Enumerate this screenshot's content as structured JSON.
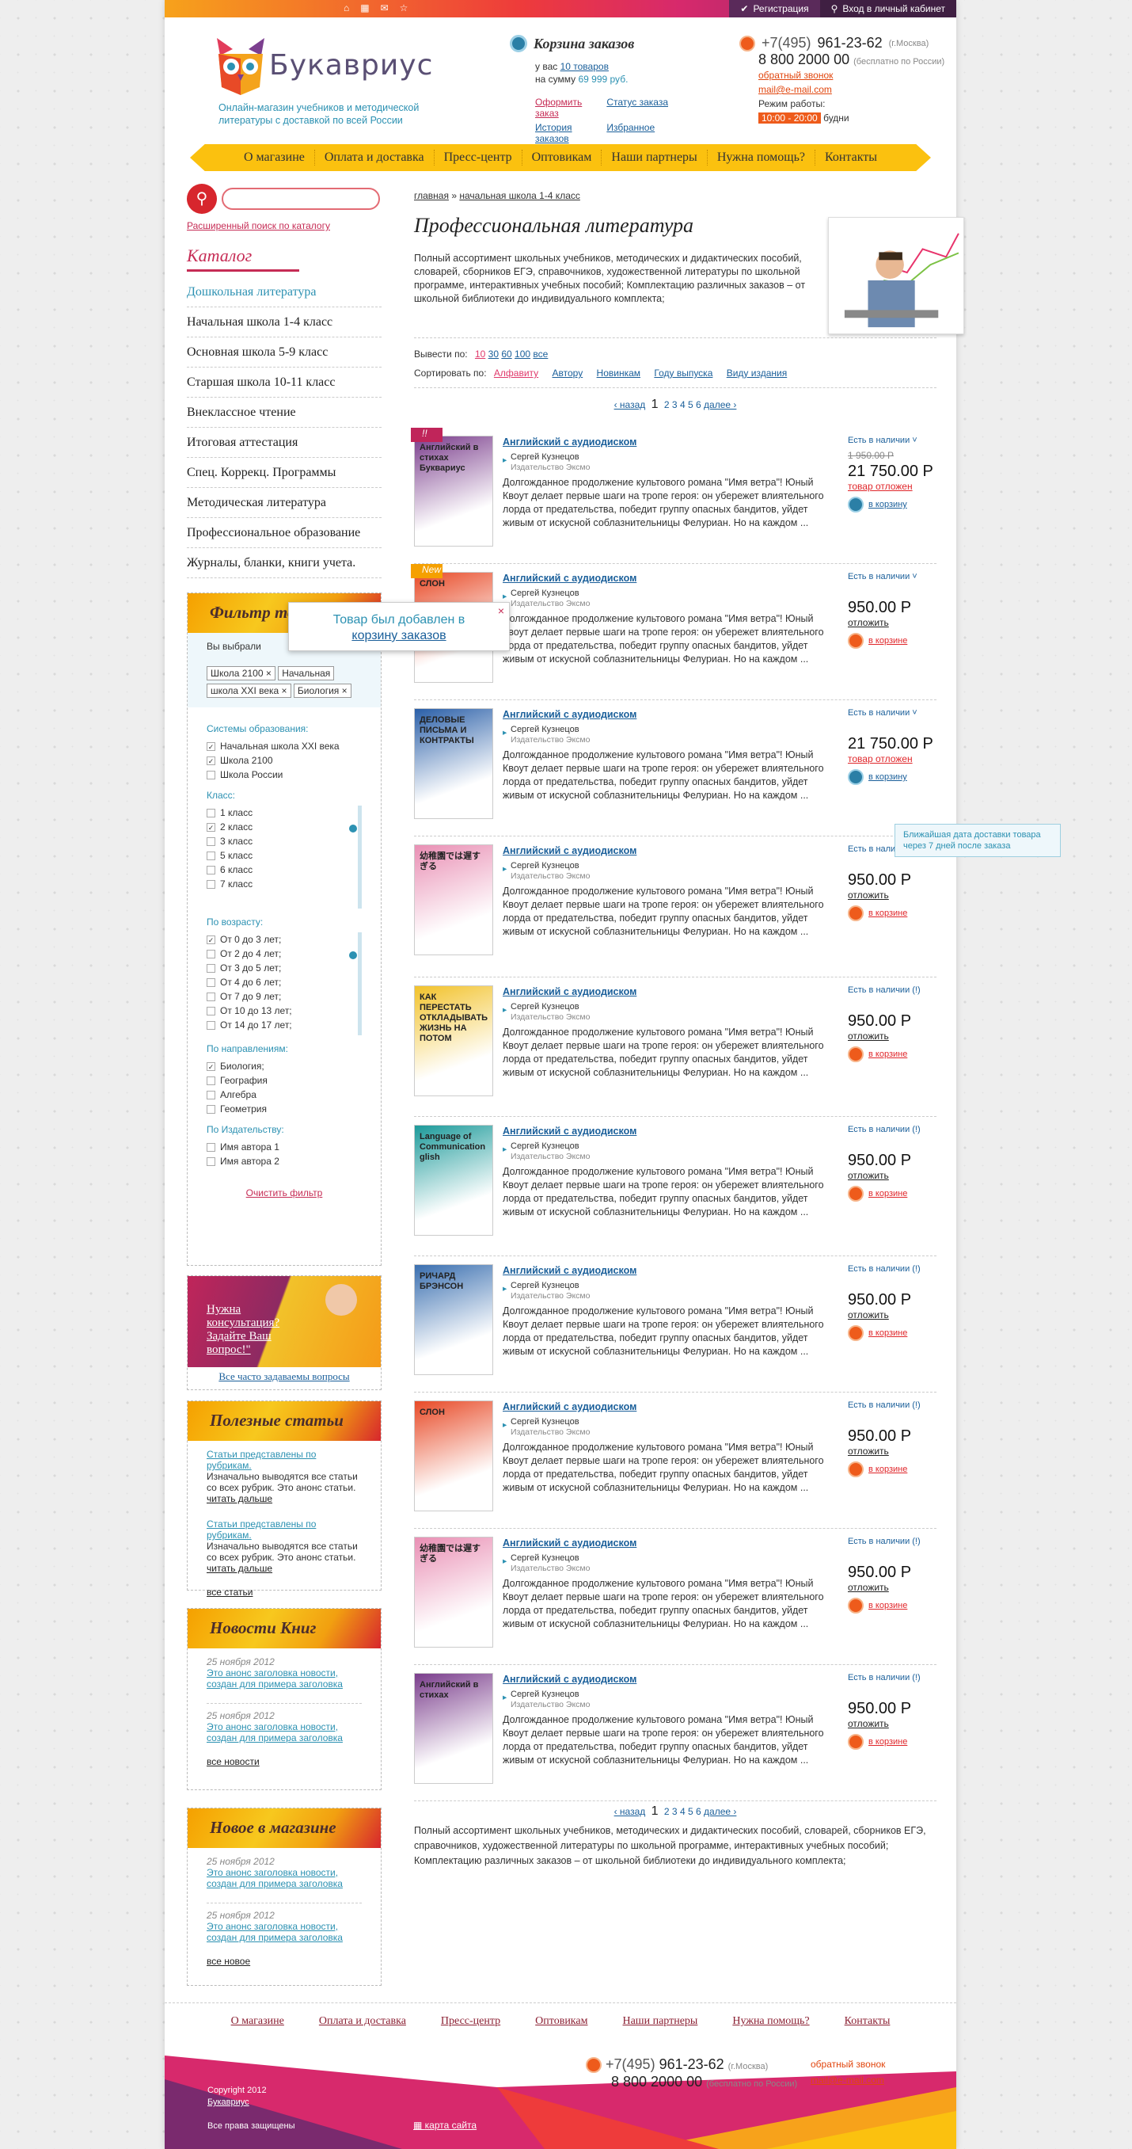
{
  "topbar": {
    "register": "Регистрация",
    "login": "Вход в личный кабинет"
  },
  "brand": {
    "name": "Букавриус",
    "tagline": "Онлайн-магазин учебников и методической литературы с доставкой по всей России"
  },
  "cart": {
    "title": "Корзина заказов",
    "sum_prefix": "у вас",
    "count": "10 товаров",
    "sum_label": "на сумму",
    "sum": "69 999 руб.",
    "links": [
      "Оформить заказ",
      "Статус заказа",
      "История заказов",
      "Избранное"
    ]
  },
  "contacts": {
    "phone1_code": "+7(495)",
    "phone1": "961-23-62",
    "phone1_city": "(г.Москва)",
    "phone2": "8 800 2000 00",
    "phone2_note": "(бесплатно по России)",
    "callback": "обратный звонок",
    "email": "mail@e-mail.com",
    "hours_label": "Режим работы:",
    "hours": "10:00 - 20:00",
    "hours_days": "будни"
  },
  "menu": [
    "О магазине",
    "Оплата и доставка",
    "Пресс-центр",
    "Оптовикам",
    "Наши партнеры",
    "Нужна помощь?",
    "Контакты"
  ],
  "search": {
    "advanced": "Расширенный поиск по каталогу"
  },
  "catalog": {
    "title": "Каталог",
    "items": [
      "Дошкольная литература",
      "Начальная школа 1-4 класс",
      "Основная школа 5-9 класс",
      "Старшая школа 10-11 класс",
      "Внеклассное чтение",
      "Итоговая аттестация",
      "Спец. Коррекц. Программы",
      "Методическая литература",
      "Профессиональное образование",
      "Журналы, бланки, книги учета."
    ]
  },
  "filter": {
    "title": "Фильтр товаров",
    "chosen_label": "Вы выбрали",
    "chips": [
      "Школа 2100",
      "Начальная",
      "школа XXI века",
      "Биология"
    ],
    "systems_label": "Системы образования:",
    "systems": [
      {
        "label": "Начальная школа XXI века",
        "checked": true
      },
      {
        "label": "Школа 2100",
        "checked": true
      },
      {
        "label": "Школа России",
        "checked": false
      }
    ],
    "class_label": "Класс:",
    "classes": [
      {
        "label": "1 класс",
        "checked": false
      },
      {
        "label": "2 класс",
        "checked": true
      },
      {
        "label": "3 класс",
        "checked": false
      },
      {
        "label": "5 класс",
        "checked": false
      },
      {
        "label": "6 класс",
        "checked": false
      },
      {
        "label": "7 класс",
        "checked": false
      }
    ],
    "age_label": "По возрасту:",
    "ages": [
      {
        "label": "От 0 до 3 лет;",
        "checked": true
      },
      {
        "label": "От 2 до 4 лет;",
        "checked": false
      },
      {
        "label": "От 3 до 5 лет;",
        "checked": false
      },
      {
        "label": "От 4 до 6 лет;",
        "checked": false
      },
      {
        "label": "От 7 до 9 лет;",
        "checked": false
      },
      {
        "label": "От 10 до 13 лет;",
        "checked": false
      },
      {
        "label": "От 14 до 17 лет;",
        "checked": false
      }
    ],
    "dir_label": "По направлениям:",
    "dirs": [
      {
        "label": "Биология;",
        "checked": true
      },
      {
        "label": "География",
        "checked": false
      },
      {
        "label": "Алгебра",
        "checked": false
      },
      {
        "label": "Геометрия",
        "checked": false
      }
    ],
    "pub_label": "По Издательству:",
    "pubs": [
      {
        "label": "Имя автора 1",
        "checked": false
      },
      {
        "label": "Имя автора 2",
        "checked": false
      }
    ],
    "clear": "Очистить фильтр"
  },
  "consult": {
    "text": "Нужна консультация? Задайте Ваш вопрос!\"",
    "faq": "Все часто задаваемы вопросы"
  },
  "articles": {
    "title": "Полезные статьи",
    "items": [
      {
        "link": "Статьи представлены по рубрикам.",
        "text": "Изначально выводятся все статьи со всех рубрик. Это анонс статьи.",
        "more": "читать дальше"
      },
      {
        "link": "Статьи представлены по рубрикам.",
        "text": "Изначально выводятся все статьи со всех рубрик. Это анонс статьи.",
        "more": "читать дальше"
      }
    ],
    "all": "все статьи"
  },
  "news": {
    "title": "Новости Книг",
    "items": [
      {
        "date": "25 ноября 2012",
        "link": "Это анонс заголовка новости, создан для примера заголовка"
      },
      {
        "date": "25 ноября 2012",
        "link": "Это анонс заголовка новости, создан для примера заголовка"
      }
    ],
    "all": "все новости"
  },
  "newin": {
    "title": "Новое в магазине",
    "items": [
      {
        "date": "25 ноября 2012",
        "link": "Это анонс заголовка новости, создан для примера заголовка"
      },
      {
        "date": "25 ноября 2012",
        "link": "Это анонс заголовка новости, создан для примера заголовка"
      }
    ],
    "all": "все новое"
  },
  "breadcrumb": {
    "home": "главная",
    "sep": "»",
    "current": "начальная школа 1-4 класс"
  },
  "main": {
    "title": "Профессиональная литература",
    "description": "Полный ассортимент школьных учебников, методических и дидактических пособий, словарей, сборников ЕГЭ, справочников, художественной литературы по школьной программе, интерактивных учебных пособий; Комплектацию различных заказов – от школьной библиотеки до индивидуального комплекта;",
    "show_label": "Вывести по:",
    "show_options": [
      "10",
      "30",
      "60",
      "100",
      "все"
    ],
    "sort_label": "Сортировать по:",
    "sort_options": [
      "Алфавиту",
      "Автору",
      "Новинкам",
      "Году выпуска",
      "Виду издания"
    ]
  },
  "pager": {
    "prev": "‹ назад",
    "pages": [
      "1",
      "2",
      "3",
      "4",
      "5",
      "6"
    ],
    "next": "далее ›"
  },
  "product_common": {
    "title": "Английский с аудиодиском",
    "author": "Сергей Кузнецов",
    "publisher": "Издательство Эксмо",
    "text": "Долгожданное продолжение культового романа \"Имя ветра\"! Юный Квоут делает первые шаги на тропе героя: он убережет влиятельного лорда от предательства, победит группу опасных бандитов, уйдет живым от искусной соблазнительницы Фелуриан. Но на каждом ..."
  },
  "products": [
    {
      "avail": "Есть в наличии ˅",
      "old": "1 950.00 Р",
      "price": "21 750.00 Р",
      "action": "товар отложен",
      "cart": "в корзину",
      "badge": "!!",
      "cover": "#7a3d8c"
    },
    {
      "avail": "Есть в наличии ˅",
      "old": "",
      "price": "950.00 Р",
      "action": "отложить",
      "cart": "в корзине",
      "badge": "New",
      "cover": "#e84a27"
    },
    {
      "avail": "Есть в наличии ˅",
      "old": "",
      "price": "21 750.00 Р",
      "action": "товар отложен",
      "cart": "в корзину",
      "badge": "",
      "cover": "#2a5fa8"
    },
    {
      "avail": "Есть в наличии (!)",
      "old": "",
      "price": "950.00 Р",
      "action": "отложить",
      "cart": "в корзине",
      "badge": "",
      "cover": "#e98fb4"
    },
    {
      "avail": "Есть в наличии (!)",
      "old": "",
      "price": "950.00 Р",
      "action": "отложить",
      "cart": "в корзине",
      "badge": "",
      "cover": "#f2c22a"
    },
    {
      "avail": "Есть в наличии (!)",
      "old": "",
      "price": "950.00 Р",
      "action": "отложить",
      "cart": "в корзине",
      "badge": "",
      "cover": "#1c9a9a"
    },
    {
      "avail": "Есть в наличии (!)",
      "old": "",
      "price": "950.00 Р",
      "action": "отложить",
      "cart": "в корзине",
      "badge": "",
      "cover": "#3a6fb0"
    },
    {
      "avail": "Есть в наличии (!)",
      "old": "",
      "price": "950.00 Р",
      "action": "отложить",
      "cart": "в корзине",
      "badge": "",
      "cover": "#e84a27"
    },
    {
      "avail": "Есть в наличии (!)",
      "old": "",
      "price": "950.00 Р",
      "action": "отложить",
      "cart": "в корзине",
      "badge": "",
      "cover": "#e98fb4"
    },
    {
      "avail": "Есть в наличии (!)",
      "old": "",
      "price": "950.00 Р",
      "action": "отложить",
      "cart": "в корзине",
      "badge": "",
      "cover": "#7a3d8c"
    }
  ],
  "popup": {
    "line1": "Товар был добавлен в",
    "link": "корзину заказов",
    "close": "×"
  },
  "tooltip": {
    "text": "Ближайшая дата доставки товара через 7 дней после заказа"
  },
  "cover_titles": [
    "Английский в стихах Буквариус",
    "СЛОН",
    "ДЕЛОВЫЕ ПИСЬМА И КОНТРАКТЫ",
    "幼稚園では遅すぎる",
    "КАК ПЕРЕСТАТЬ ОТКЛАДЫВАТЬ ЖИЗНЬ НА ПОТОМ",
    "Language of Communication glish",
    "РИЧАРД БРЭНСОН",
    "СЛОН",
    "幼稚園では遅すぎる",
    "Английский в стихах"
  ],
  "bottom_description": "Полный ассортимент школьных учебников, методических и дидактических пособий, словарей, сборников ЕГЭ, справочников, художественной литературы по школьной программе, интерактивных учебных пособий; Комплектацию различных заказов – от школьной библиотеки до индивидуального комплекта;",
  "footer": {
    "copyright": "Copyright 2012",
    "brand": "Букавриус",
    "rights": "Все права защищены",
    "map": "карта сайта"
  }
}
